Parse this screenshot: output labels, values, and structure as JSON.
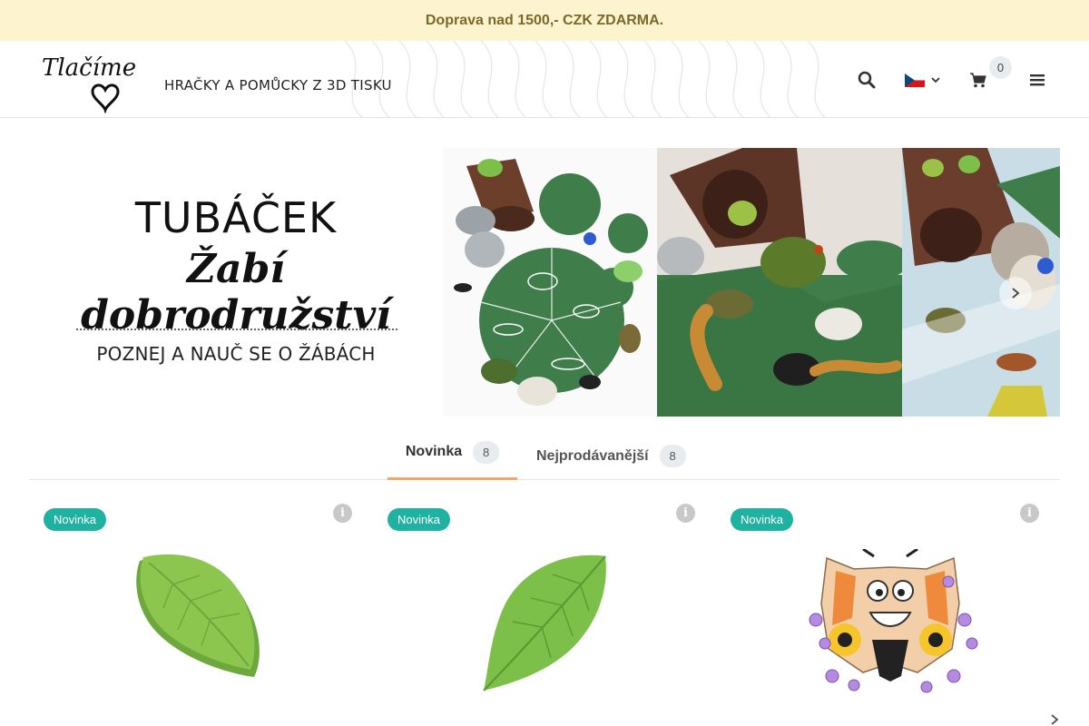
{
  "promo": {
    "text": "Doprava nad 1500,- CZK ZDARMA."
  },
  "header": {
    "logo_text": "Tlačíme s",
    "tagline": "HRAČKY A POMŮCKY Z 3D TISKU",
    "cart_count": "0",
    "icons": {
      "search": "search-icon",
      "flag": "czech-flag-icon",
      "chevron": "chevron-down-icon",
      "cart": "cart-icon",
      "menu": "hamburger-icon"
    }
  },
  "hero": {
    "title": "TUBÁČEK",
    "subtitle": "Žabí dobrodružství",
    "caption": "POZNEJ A NAUČ SE O ŽÁBÁCH"
  },
  "tabs": [
    {
      "label": "Novinka",
      "count": "8",
      "active": true
    },
    {
      "label": "Nejprodávanější",
      "count": "8",
      "active": false
    }
  ],
  "products": [
    {
      "badge": "Novinka",
      "image": "leaf-dish"
    },
    {
      "badge": "Novinka",
      "image": "leaf-plate"
    },
    {
      "badge": "Novinka",
      "image": "butterfly-puzzle"
    }
  ],
  "colors": {
    "promo_bg": "#fdf3cf",
    "badge": "#20b2a0",
    "tab_active": "#f6a66a",
    "leaf_green": "#7cc04a"
  }
}
